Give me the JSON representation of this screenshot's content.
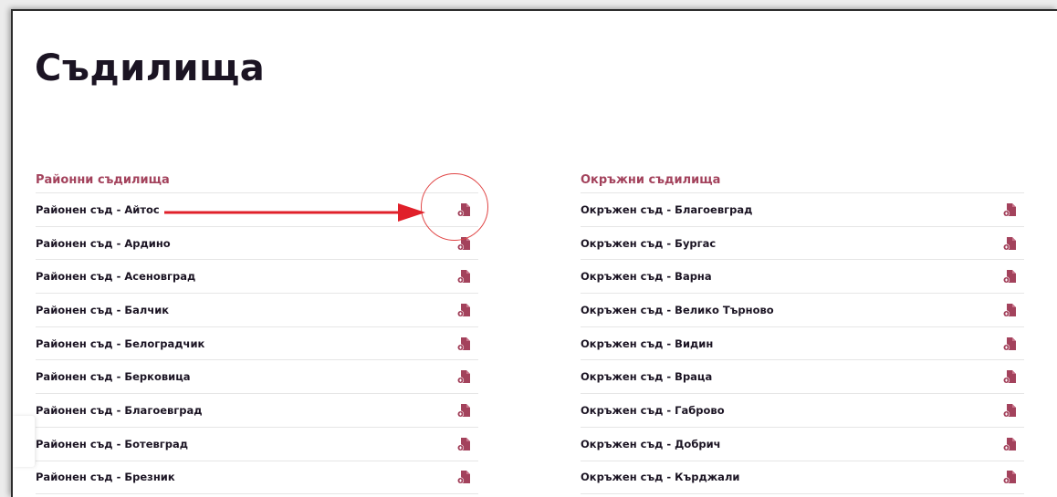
{
  "page": {
    "title": "Съдилища"
  },
  "left": {
    "heading": "Районни съдилища",
    "items": [
      {
        "label": "Районен съд - Айтос",
        "icon": "document-download-icon"
      },
      {
        "label": "Районен съд - Ардино",
        "icon": "document-download-icon"
      },
      {
        "label": "Районен съд - Асеновград",
        "icon": "document-download-icon"
      },
      {
        "label": "Районен съд - Балчик",
        "icon": "document-download-icon"
      },
      {
        "label": "Районен съд - Белоградчик",
        "icon": "document-download-icon"
      },
      {
        "label": "Районен съд - Берковица",
        "icon": "document-download-icon"
      },
      {
        "label": "Районен съд - Благоевград",
        "icon": "document-download-icon"
      },
      {
        "label": "Районен съд - Ботевград",
        "icon": "document-download-icon"
      },
      {
        "label": "Районен съд - Брезник",
        "icon": "document-download-icon"
      }
    ]
  },
  "right": {
    "heading": "Окръжни съдилища",
    "items": [
      {
        "label": "Окръжен съд - Благоевград",
        "icon": "document-download-icon"
      },
      {
        "label": "Окръжен съд - Бургас",
        "icon": "document-download-icon"
      },
      {
        "label": "Окръжен съд - Варна",
        "icon": "document-download-icon"
      },
      {
        "label": "Окръжен съд - Велико Търново",
        "icon": "document-download-icon"
      },
      {
        "label": "Окръжен съд - Видин",
        "icon": "document-download-icon"
      },
      {
        "label": "Окръжен съд - Враца",
        "icon": "document-download-icon"
      },
      {
        "label": "Окръжен съд - Габрово",
        "icon": "document-download-icon"
      },
      {
        "label": "Окръжен съд - Добрич",
        "icon": "document-download-icon"
      },
      {
        "label": "Окръжен съд - Кърджали",
        "icon": "document-download-icon"
      }
    ]
  },
  "colors": {
    "accent": "#a3425c",
    "text": "#1b1423",
    "annotation": "#e0202a"
  },
  "annotation": {
    "type": "red-arrow-and-circle",
    "target": "left.items.0"
  }
}
